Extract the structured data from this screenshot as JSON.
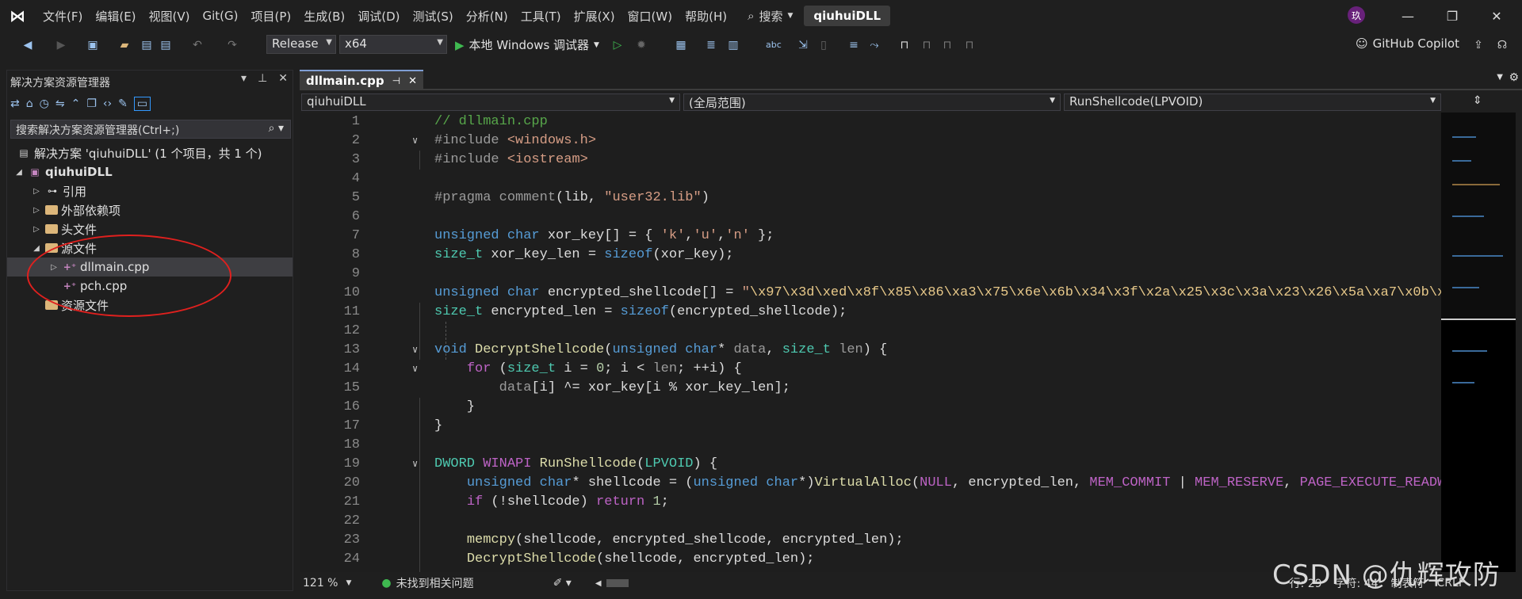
{
  "menu": [
    "文件(F)",
    "编辑(E)",
    "视图(V)",
    "Git(G)",
    "项目(P)",
    "生成(B)",
    "调试(D)",
    "测试(S)",
    "分析(N)",
    "工具(T)",
    "扩展(X)",
    "窗口(W)",
    "帮助(H)"
  ],
  "search_label": "搜索",
  "project_name": "qiuhuiDLL",
  "avatar_text": "玖",
  "toolbar": {
    "config": "Release",
    "platform": "x64",
    "debugger": "本地 Windows 调试器",
    "copilot": "GitHub Copilot"
  },
  "solution_explorer": {
    "title": "解决方案资源管理器",
    "search_placeholder": "搜索解决方案资源管理器(Ctrl+;)",
    "items": [
      {
        "label": "解决方案 'qiuhuiDLL' (1 个项目，共 1 个)"
      },
      {
        "label": "qiuhuiDLL"
      },
      {
        "label": "引用"
      },
      {
        "label": "外部依赖项"
      },
      {
        "label": "头文件"
      },
      {
        "label": "源文件"
      },
      {
        "label": "dllmain.cpp"
      },
      {
        "label": "pch.cpp"
      },
      {
        "label": "资源文件"
      }
    ]
  },
  "editor": {
    "tab": "dllmain.cpp",
    "nav_project": "qiuhuiDLL",
    "nav_scope": "(全局范围)",
    "nav_member": "RunShellcode(LPVOID)"
  },
  "code_lines": [
    "1",
    "2",
    "3",
    "4",
    "5",
    "6",
    "7",
    "8",
    "9",
    "10",
    "11",
    "12",
    "13",
    "14",
    "15",
    "16",
    "17",
    "18",
    "19",
    "20",
    "21",
    "22",
    "23",
    "24"
  ],
  "status": {
    "zoom": "121 %",
    "issues": "未找到相关问题",
    "line": "行: 29",
    "char": "字符: 44",
    "mode": "制表符",
    "encoding": "CRLF"
  },
  "watermark": "CSDN @仇辉攻防"
}
